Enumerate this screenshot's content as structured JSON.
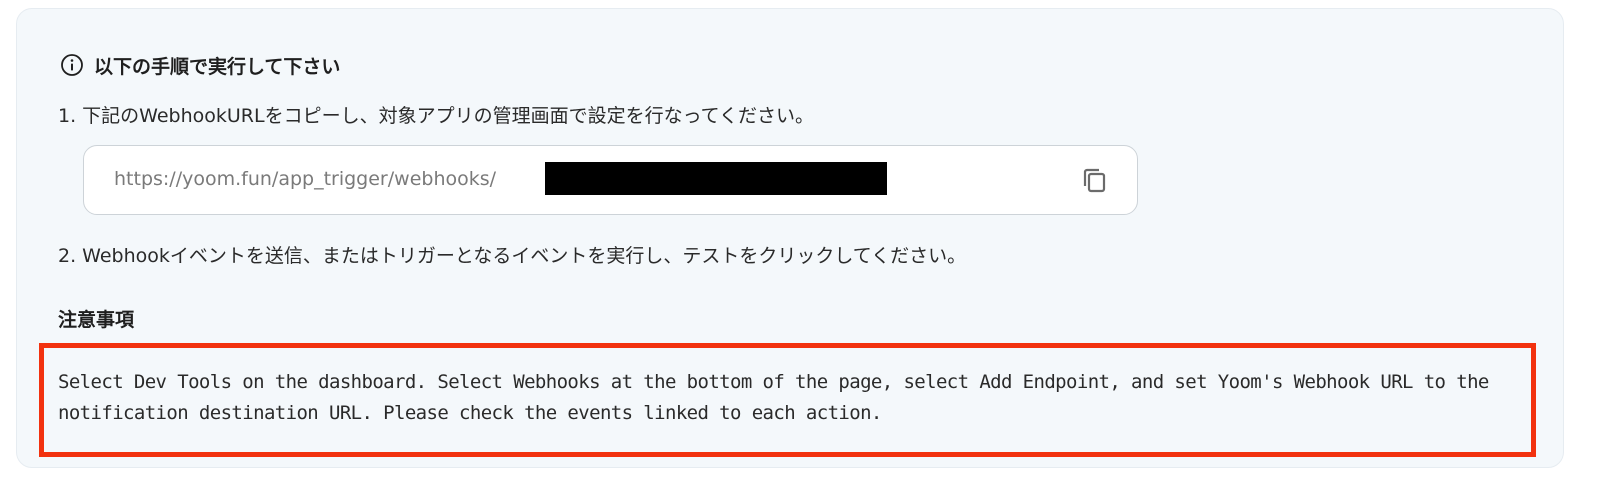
{
  "instructions": {
    "heading": "以下の手順で実行して下さい",
    "step1": "1. 下記のWebhookURLをコピーし、対象アプリの管理画面で設定を行なってください。",
    "webhook_url": "https://yoom.fun/app_trigger/webhooks/",
    "step2": "2. Webhookイベントを送信、またはトリガーとなるイベントを実行し、テストをクリックしてください。"
  },
  "notes": {
    "heading": "注意事項",
    "body": "Select Dev Tools on the dashboard. Select Webhooks at the bottom of the page, select Add Endpoint, and set Yoom's Webhook URL to the notification destination URL. Please check the events linked to each action."
  },
  "icons": {
    "info": "info-circle-icon",
    "copy": "copy-icon"
  },
  "colors": {
    "panel_bg": "#f4f8fb",
    "highlight_border": "#f2320f",
    "redaction": "#000000"
  }
}
